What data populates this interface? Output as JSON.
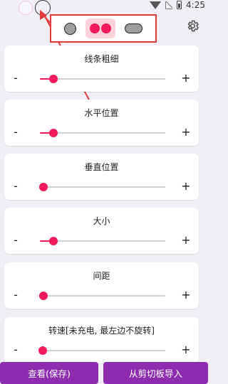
{
  "status_bar": {
    "time": "4:25"
  },
  "style_options": [
    {
      "name": "single-circle"
    },
    {
      "name": "double-circle",
      "selected": true
    },
    {
      "name": "pill"
    }
  ],
  "accent_color": "#f21a5c",
  "button_color": "#8d2cae",
  "sliders": [
    {
      "label": "线条粗细",
      "value": 0.11
    },
    {
      "label": "水平位置",
      "value": 0.11
    },
    {
      "label": "垂直位置",
      "value": 0.03
    },
    {
      "label": "大小",
      "value": 0.11
    },
    {
      "label": "间距",
      "value": 0.03
    },
    {
      "label": "转速[未充电, 最左边不旋转]",
      "value": 0.02
    }
  ],
  "controls": {
    "minus": "-",
    "plus": "+"
  },
  "buttons": {
    "view_save": "查看(保存)",
    "import_clipboard": "从剪切板导入"
  }
}
